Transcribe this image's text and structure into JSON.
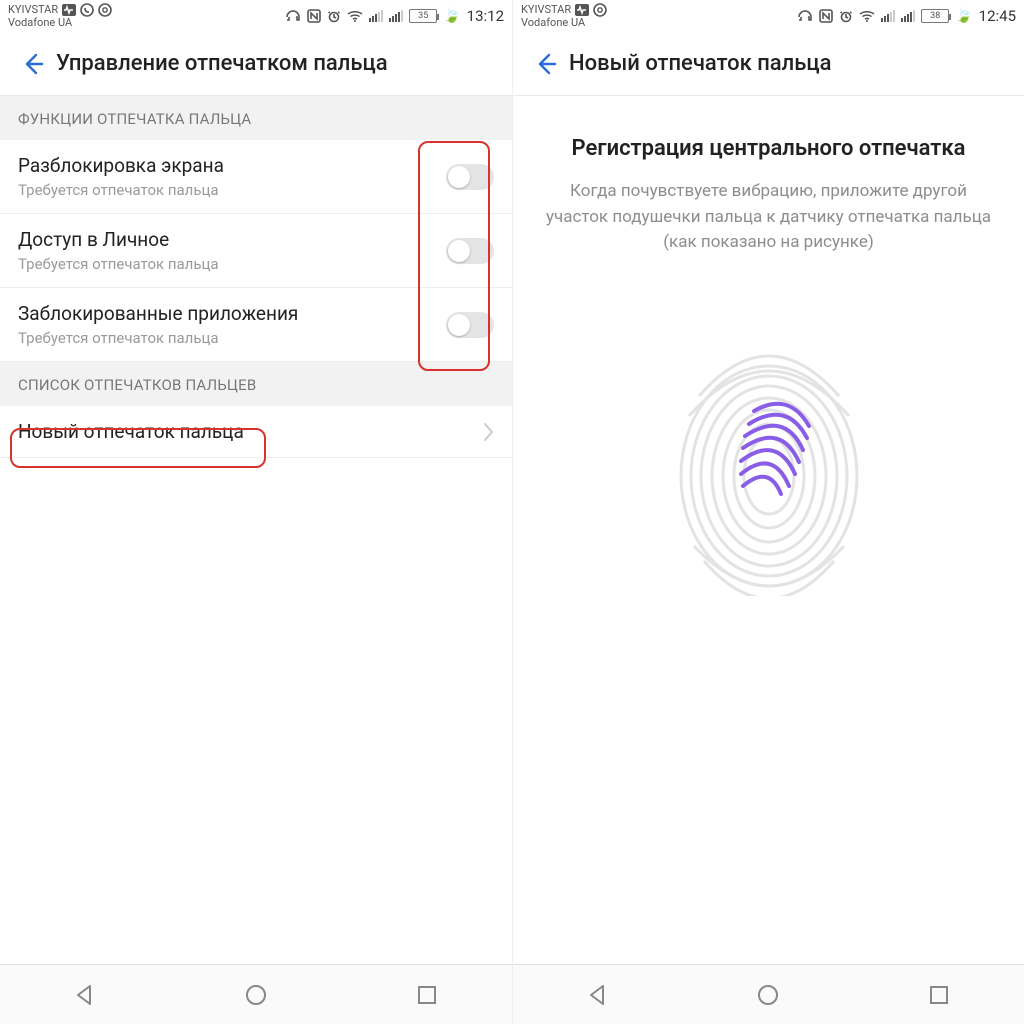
{
  "left": {
    "status": {
      "carrier1": "KYIVSTAR",
      "carrier2": "Vodafone UA",
      "battery": "35",
      "time": "13:12"
    },
    "appbar": {
      "title": "Управление отпечатком пальца"
    },
    "sections": {
      "functions_head": "ФУНКЦИИ ОТПЕЧАТКА ПАЛЬЦА",
      "list_head": "СПИСОК ОТПЕЧАТКОВ ПАЛЬЦЕВ"
    },
    "rows": [
      {
        "title": "Разблокировка экрана",
        "sub": "Требуется отпечаток пальца",
        "on": false
      },
      {
        "title": "Доступ в Личное",
        "sub": "Требуется отпечаток пальца",
        "on": false
      },
      {
        "title": "Заблокированные приложения",
        "sub": "Требуется отпечаток пальца",
        "on": false
      }
    ],
    "new_row": {
      "title": "Новый отпечаток пальца"
    }
  },
  "right": {
    "status": {
      "carrier1": "KYIVSTAR",
      "carrier2": "Vodafone UA",
      "battery": "38",
      "time": "12:45"
    },
    "appbar": {
      "title": "Новый отпечаток пальца"
    },
    "enroll": {
      "title": "Регистрация центрального отпечатка",
      "desc": "Когда почувствуете вибрацию, приложите другой участок подушечки пальца к датчику отпечатка пальца (как показано на рисунке)"
    }
  },
  "icons": {
    "leaf": "🍃"
  }
}
